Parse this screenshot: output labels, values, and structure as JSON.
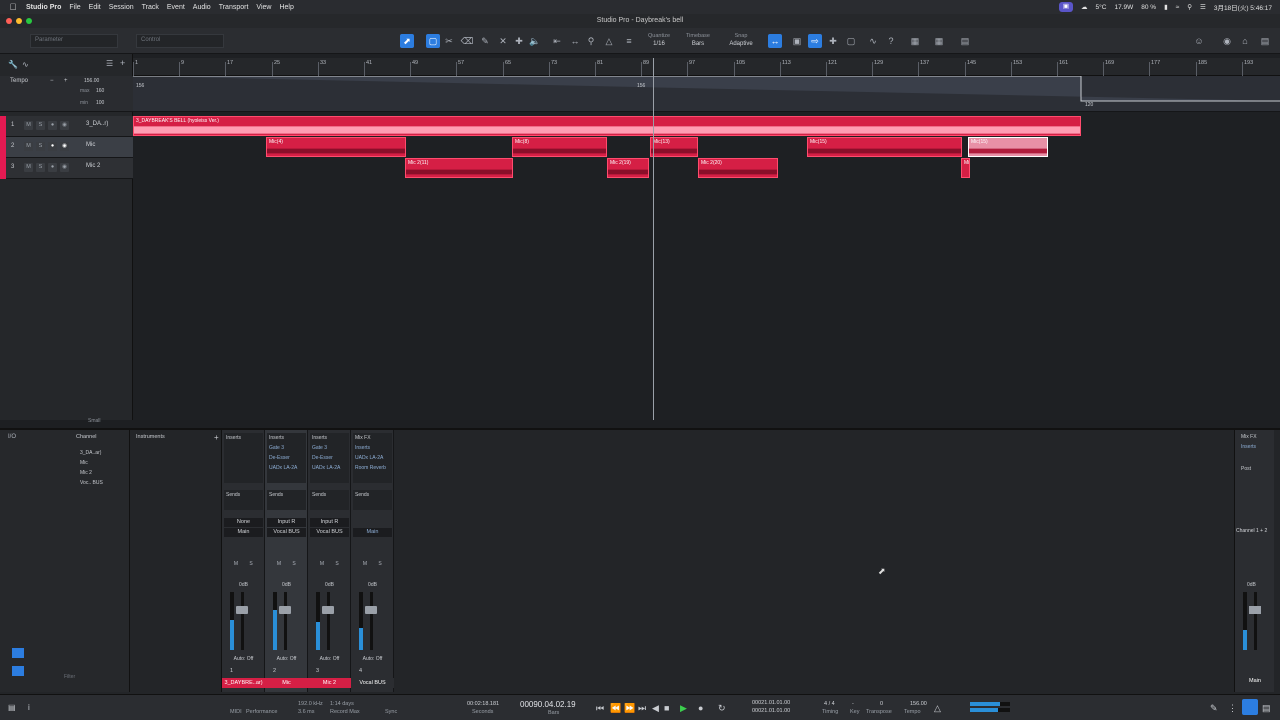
{
  "menubar": {
    "app": "Studio Pro",
    "items": [
      "File",
      "Edit",
      "Session",
      "Track",
      "Event",
      "Audio",
      "Transport",
      "View",
      "Help"
    ],
    "status": {
      "weather": "5°C",
      "power": "17.9W",
      "battery": "80 %",
      "datetime": "3月18日(火) 5:46:17"
    }
  },
  "window": {
    "title": "Studio Pro - Daybreak's bell"
  },
  "toolbar": {
    "parameter_placeholder": "Parameter",
    "control_placeholder": "Control",
    "quantize_label": "Quantize",
    "quantize_value": "1/16",
    "timebase_label": "Timebase",
    "timebase_value": "Bars",
    "snap_label": "Snap",
    "snap_value": "Adaptive"
  },
  "tempo_track": {
    "label": "Tempo",
    "value": "156.00",
    "max_label": "max",
    "max": "160",
    "min_label": "min",
    "min": "100",
    "point_a": "156",
    "point_b": "156",
    "point_c": "120"
  },
  "ruler": {
    "labels": [
      "1",
      "9",
      "17",
      "25",
      "33",
      "41",
      "49",
      "57",
      "65",
      "73",
      "81",
      "89",
      "97",
      "105",
      "113",
      "121",
      "129",
      "137",
      "145",
      "153",
      "161",
      "169",
      "177",
      "185",
      "193"
    ]
  },
  "tracks": [
    {
      "num": "1",
      "name": "3_DA..r)",
      "m": "M",
      "s": "S"
    },
    {
      "num": "2",
      "name": "Mic",
      "m": "M",
      "s": "S"
    },
    {
      "num": "3",
      "name": "Mic 2",
      "m": "M",
      "s": "S"
    }
  ],
  "clips": {
    "main": "3_DAYBREAK'S BELL (hyoleiss Ver.)",
    "mic_a": "Mic(4)",
    "mic_b": "Mic(8)",
    "mic_c": "Mic(13)",
    "mic_d": "Mic(15)",
    "mic_e": "Mic(15)",
    "mic2_a": "Mic 2(11)",
    "mic2_b": "Mic 2(19)",
    "mic2_c": "Mic 2(20)",
    "mic2_d": "Mi"
  },
  "trackhead_footer": {
    "size": "Small"
  },
  "console": {
    "channel_label": "Channel",
    "instruments_label": "Instruments",
    "channel_list": [
      "3_DA..ar)",
      "Mic",
      "Mic 2",
      "Voc.. BUS"
    ],
    "filter_placeholder": "Filter",
    "strips": [
      {
        "inserts_hdr": "Inserts",
        "inserts": [],
        "sends_hdr": "Sends",
        "input": "None",
        "output": "Main",
        "db": "0dB",
        "auto": "Auto: Off",
        "idx": "1",
        "label": "3_DAYBRE..ar)"
      },
      {
        "inserts_hdr": "Inserts",
        "inserts": [
          "Gate 3",
          "De-Esser",
          "UADx LA-2A"
        ],
        "sends_hdr": "Sends",
        "input": "Input R",
        "output": "Vocal BUS",
        "db": "0dB",
        "auto": "Auto: Off",
        "idx": "2",
        "label": "Mic"
      },
      {
        "inserts_hdr": "Inserts",
        "inserts": [
          "Gate 3",
          "De-Esser",
          "UADx LA-2A"
        ],
        "sends_hdr": "Sends",
        "input": "Input R",
        "output": "Vocal BUS",
        "db": "0dB",
        "auto": "Auto: Off",
        "idx": "3",
        "label": "Mic 2"
      },
      {
        "inserts_hdr": "Mix FX",
        "inserts": [
          "Inserts",
          "UADx LA-2A",
          "Room Reverb"
        ],
        "sends_hdr": "Sends",
        "input": "",
        "output": "Main",
        "db": "0dB",
        "auto": "Auto: Off",
        "idx": "4",
        "label": "Vocal BUS"
      }
    ],
    "master": {
      "mixfx": "Mix FX",
      "inserts": "Inserts",
      "post": "Post",
      "name": "Channel 1 + 2",
      "db": "0dB",
      "label": "Main"
    }
  },
  "transport": {
    "midi": "MIDI",
    "performance": "Performance",
    "sample_rate": "192.0 kHz",
    "latency": "3.6 ms",
    "record_time": "1:14 days",
    "record_max": "Record Max",
    "sync": "Sync",
    "seconds_value": "00:02:18.181",
    "seconds_label": "Seconds",
    "bars_value": "00090.04.02.19",
    "bars_label": "Bars",
    "loop_l": "00021.01.01.00",
    "loop_r": "00021.01.01.00",
    "timing_value": "4 / 4",
    "timing_label": "Timing",
    "key_value": "-",
    "key_label": "Key",
    "transpose_value": "0",
    "transpose_label": "Transpose",
    "tempo_value": "156.00",
    "tempo_label": "Tempo"
  },
  "colors": {
    "track": "#d51f45",
    "accent": "#2c7de0"
  }
}
